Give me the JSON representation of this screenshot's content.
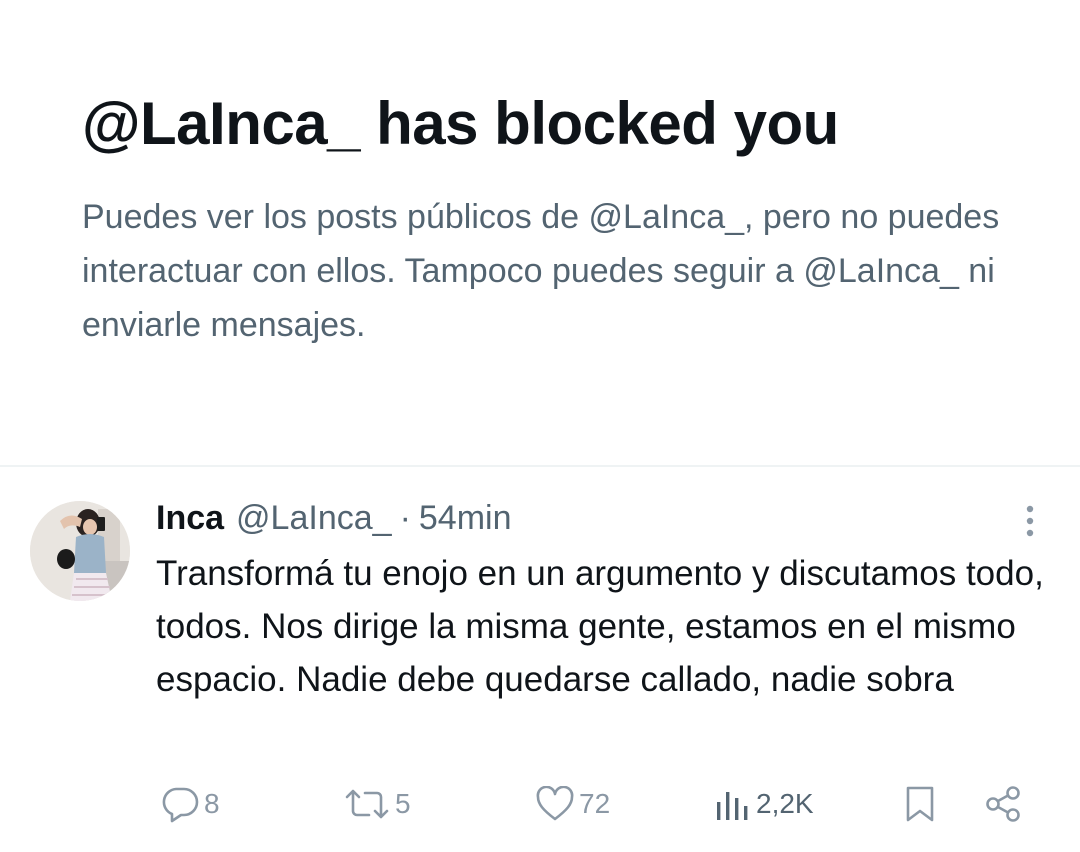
{
  "blocked": {
    "title": "@LaInca_ has blocked you",
    "description": "Puedes ver los posts públicos de @LaInca_, pero no puedes interactuar con ellos. Tampoco puedes seguir a @LaInca_ ni enviarle mensajes."
  },
  "tweet": {
    "display_name": "Inca",
    "handle": "@LaInca_",
    "separator": "·",
    "time": "54min",
    "text": "Transformá tu enojo en un argumento y discutamos todo, todos. Nos dirige la misma gente, estamos en el mismo espacio. Nadie debe quedarse callado, nadie sobra",
    "actions": {
      "replies": "8",
      "reposts": "5",
      "likes": "72",
      "views": "2,2K"
    }
  },
  "icons": {
    "reply": "reply-icon",
    "repost": "repost-icon",
    "like": "heart-icon",
    "views": "views-chart-icon",
    "bookmark": "bookmark-icon",
    "share": "share-icon",
    "more": "more-vertical-icon"
  },
  "colors": {
    "text_primary": "#0f1419",
    "text_secondary": "#536471",
    "icon_muted": "#8b98a5",
    "divider": "#eff3f4"
  }
}
